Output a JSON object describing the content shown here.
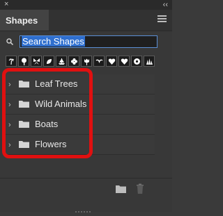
{
  "panel": {
    "title": "Shapes",
    "close_symbol": "×",
    "collapse_symbol": "‹‹"
  },
  "search": {
    "value": "Search Shapes"
  },
  "shape_icons": [
    "palm-tree-icon",
    "tree-icon",
    "butterfly-icon",
    "leaf-icon",
    "ship-icon",
    "flower-icon",
    "tulip-icon",
    "bird-icon",
    "heart-icon",
    "heart-outline-icon",
    "flower-outline-icon",
    "grass-icon"
  ],
  "groups": [
    {
      "label": "Leaf Trees"
    },
    {
      "label": "Wild Animals"
    },
    {
      "label": "Boats"
    },
    {
      "label": "Flowers"
    }
  ],
  "colors": {
    "highlight_border": "#e01010",
    "selection": "#2f6fcf"
  }
}
